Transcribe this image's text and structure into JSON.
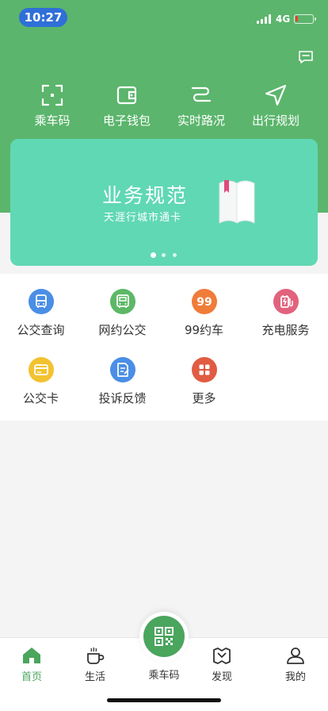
{
  "status_bar": {
    "time": "10:27",
    "network": "4G",
    "battery_level": 0.15
  },
  "quick_actions": [
    {
      "label": "乘车码",
      "icon": "scan-icon"
    },
    {
      "label": "电子钱包",
      "icon": "wallet-icon"
    },
    {
      "label": "实时路况",
      "icon": "route-icon"
    },
    {
      "label": "出行规划",
      "icon": "navigation-icon"
    }
  ],
  "banner": {
    "title": "业务规范",
    "subtitle": "天涯行城市通卡",
    "dots": 3,
    "active_dot": 0
  },
  "services": [
    {
      "label": "公交查询",
      "icon": "bus-icon",
      "color": "#4a8ee6"
    },
    {
      "label": "网约公交",
      "icon": "smart-bus-icon",
      "color": "#5cb866"
    },
    {
      "label": "99约车",
      "icon": "99-car-icon",
      "color": "#f07c3a"
    },
    {
      "label": "充电服务",
      "icon": "charging-icon",
      "color": "#e2627d"
    },
    {
      "label": "公交卡",
      "icon": "card-icon",
      "color": "#f2c230"
    },
    {
      "label": "投诉反馈",
      "icon": "feedback-icon",
      "color": "#4a8ee6"
    },
    {
      "label": "更多",
      "icon": "grid-icon",
      "color": "#e05c43"
    }
  ],
  "tabbar": {
    "tabs": [
      {
        "label": "首页",
        "icon": "home-icon",
        "active": true
      },
      {
        "label": "生活",
        "icon": "coffee-icon",
        "active": false
      },
      {
        "label": "乘车码",
        "icon": "qr-code-icon",
        "active": false
      },
      {
        "label": "发现",
        "icon": "discover-icon",
        "active": false
      },
      {
        "label": "我的",
        "icon": "profile-icon",
        "active": false
      }
    ]
  },
  "colors": {
    "header_green": "#5bb56c",
    "banner_teal": "#60d8b4",
    "accent_green": "#4aa55d"
  }
}
